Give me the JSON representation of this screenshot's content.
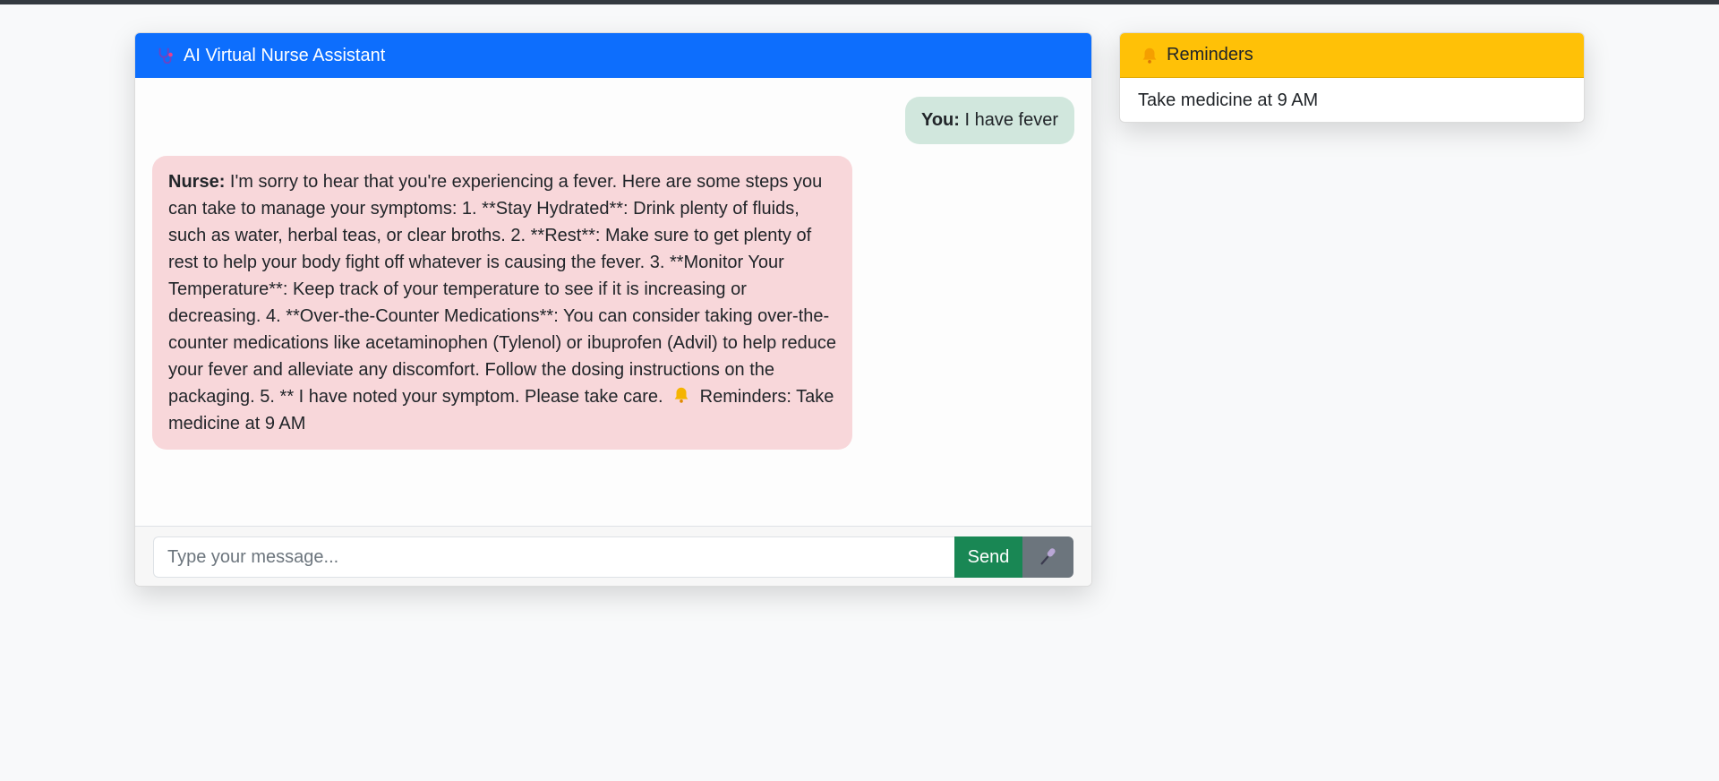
{
  "chat": {
    "title": "AI Virtual Nurse Assistant",
    "header_icon": "stethoscope-icon",
    "messages": {
      "user": {
        "sender": "You:",
        "text": "I have fever"
      },
      "nurse": {
        "sender": "Nurse:",
        "text": "I'm sorry to hear that you're experiencing a fever. Here are some steps you can take to manage your symptoms: 1. **Stay Hydrated**: Drink plenty of fluids, such as water, herbal teas, or clear broths. 2. **Rest**: Make sure to get plenty of rest to help your body fight off whatever is causing the fever. 3. **Monitor Your Temperature**: Keep track of your temperature to see if it is increasing or decreasing. 4. **Over-the-Counter Medications**: You can consider taking over-the-counter medications like acetaminophen (Tylenol) or ibuprofen (Advil) to help reduce your fever and alleviate any discomfort. Follow the dosing instructions on the packaging. 5. ** I have noted your symptom. Please take care.",
        "reminder_label": "Reminders:",
        "reminder_text": "Take medicine at 9 AM",
        "icon": "bell-icon"
      }
    },
    "input": {
      "placeholder": "Type your message...",
      "value": ""
    },
    "send_label": "Send",
    "mic_icon": "microphone-icon"
  },
  "reminders": {
    "title": "Reminders",
    "icon": "bell-icon",
    "items": [
      "Take medicine at 9 AM"
    ]
  },
  "colors": {
    "primary": "#0d6efd",
    "warning": "#ffc107",
    "success": "#198754",
    "secondary": "#6c757d",
    "user_bubble": "#d1e7dd",
    "nurse_bubble": "#f8d7da"
  }
}
